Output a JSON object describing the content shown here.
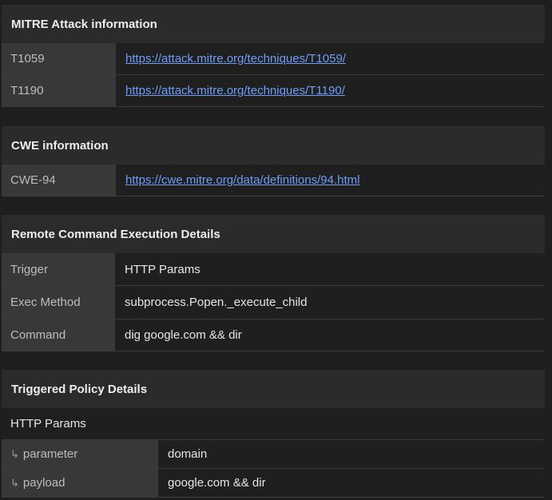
{
  "mitre": {
    "title": "MITRE Attack information",
    "rows": [
      {
        "key": "T1059",
        "link": "https://attack.mitre.org/techniques/T1059/"
      },
      {
        "key": "T1190",
        "link": "https://attack.mitre.org/techniques/T1190/"
      }
    ]
  },
  "cwe": {
    "title": "CWE information",
    "rows": [
      {
        "key": "CWE-94",
        "link": "https://cwe.mitre.org/data/definitions/94.html"
      }
    ]
  },
  "rce": {
    "title": "Remote Command Execution Details",
    "rows": [
      {
        "key": "Trigger",
        "value": "HTTP Params"
      },
      {
        "key": "Exec Method",
        "value": "subprocess.Popen._execute_child"
      },
      {
        "key": "Command",
        "value": "dig google.com && dir"
      }
    ]
  },
  "policy": {
    "title": "Triggered Policy Details",
    "subheading": "HTTP Params",
    "rows": [
      {
        "icon": "arrow-return-icon",
        "key": "parameter",
        "value": "domain"
      },
      {
        "icon": "arrow-return-icon",
        "key": "payload",
        "value": "google.com && dir"
      }
    ]
  }
}
